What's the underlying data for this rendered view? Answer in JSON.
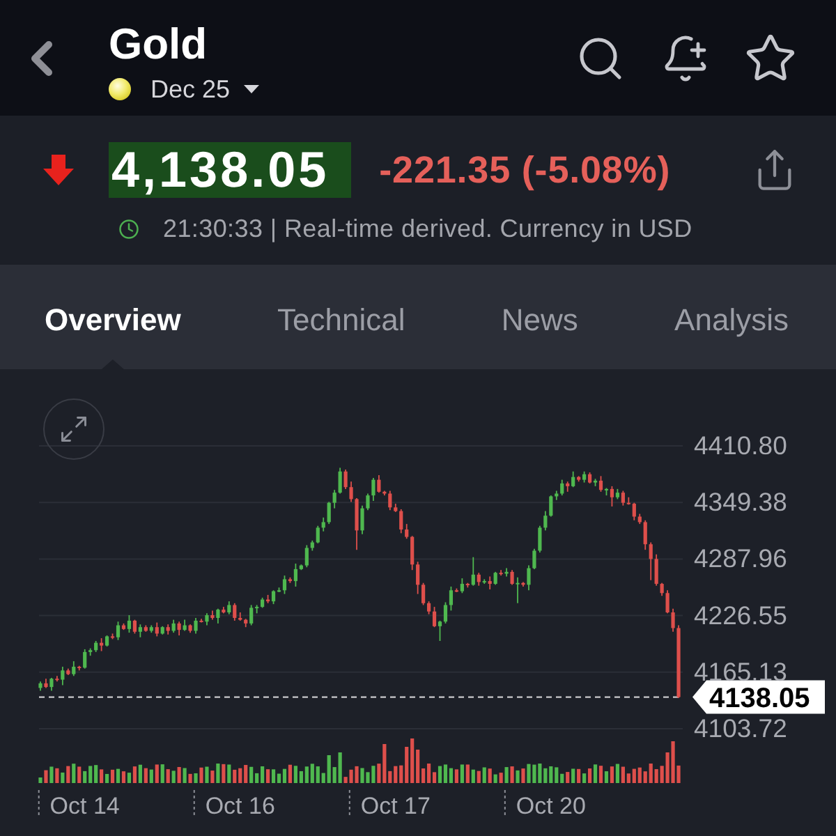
{
  "header": {
    "title": "Gold",
    "contract": "Dec 25"
  },
  "quote": {
    "down": true,
    "price": "4,138.05",
    "change": "-221.35 (-5.08%)",
    "status": "21:30:33 | Real-time derived. Currency in USD"
  },
  "tabs": [
    {
      "label": "Overview",
      "selected": true
    },
    {
      "label": "Technical",
      "selected": false
    },
    {
      "label": "News",
      "selected": false
    },
    {
      "label": "Analysis",
      "selected": false
    }
  ],
  "chart": {
    "chart_data": {
      "type": "candlestick",
      "categories": [
        null,
        null,
        null,
        null,
        null,
        null,
        null,
        null,
        "Oct 14",
        null,
        null,
        null,
        null,
        null,
        null,
        null,
        null,
        null,
        null,
        null,
        null,
        null,
        null,
        null,
        null,
        null,
        null,
        null,
        null,
        null,
        null,
        null,
        null,
        null,
        null,
        null,
        "Oct 16",
        null,
        null,
        null,
        null,
        null,
        null,
        null,
        null,
        null,
        null,
        null,
        null,
        null,
        null,
        null,
        null,
        null,
        null,
        null,
        null,
        null,
        null,
        null,
        null,
        null,
        null,
        null,
        "Oct 17",
        null,
        null,
        null,
        null,
        null,
        null,
        null,
        null,
        null,
        null,
        null,
        null,
        null,
        null,
        null,
        null,
        null,
        null,
        null,
        null,
        null,
        null,
        null,
        null,
        null,
        null,
        null,
        "Oct 20",
        null,
        null,
        null,
        null,
        null,
        null,
        null,
        null,
        null,
        null,
        null,
        null,
        null,
        null,
        null,
        null,
        null,
        null,
        null,
        null,
        null,
        null,
        null
      ],
      "ohlc": [
        [
          4148,
          4155,
          4145,
          4153
        ],
        [
          4153,
          4158,
          4148,
          4149
        ],
        [
          4149,
          4159,
          4145,
          4158
        ],
        [
          4158,
          4161,
          4155,
          4157
        ],
        [
          4157,
          4171,
          4151,
          4167
        ],
        [
          4167,
          4169,
          4162,
          4163
        ],
        [
          4163,
          4177,
          4161,
          4171
        ],
        [
          4171,
          4172,
          4167,
          4170
        ],
        [
          4170,
          4190,
          4169,
          4187
        ],
        [
          4187,
          4191,
          4183,
          4189
        ],
        [
          4189,
          4199,
          4187,
          4197
        ],
        [
          4197,
          4202,
          4188,
          4194
        ],
        [
          4194,
          4205,
          4193,
          4204
        ],
        [
          4204,
          4207,
          4201,
          4203
        ],
        [
          4203,
          4220,
          4200,
          4216
        ],
        [
          4216,
          4218,
          4211,
          4212
        ],
        [
          4212,
          4227,
          4208,
          4221
        ],
        [
          4221,
          4222,
          4207,
          4209
        ],
        [
          4209,
          4217,
          4203,
          4214
        ],
        [
          4214,
          4216,
          4209,
          4210
        ],
        [
          4210,
          4216,
          4208,
          4214
        ],
        [
          4214,
          4219,
          4204,
          4207
        ],
        [
          4207,
          4215,
          4206,
          4214
        ],
        [
          4214,
          4217,
          4206,
          4210
        ],
        [
          4210,
          4222,
          4208,
          4218
        ],
        [
          4218,
          4220,
          4205,
          4211
        ],
        [
          4211,
          4222,
          4210,
          4216
        ],
        [
          4216,
          4217,
          4208,
          4210
        ],
        [
          4210,
          4224,
          4207,
          4221
        ],
        [
          4221,
          4223,
          4219,
          4220
        ],
        [
          4220,
          4229,
          4216,
          4227
        ],
        [
          4227,
          4232,
          4222,
          4224
        ],
        [
          4224,
          4234,
          4218,
          4233
        ],
        [
          4233,
          4236,
          4229,
          4230
        ],
        [
          4230,
          4242,
          4228,
          4238
        ],
        [
          4238,
          4240,
          4221,
          4224
        ],
        [
          4224,
          4230,
          4221,
          4222
        ],
        [
          4222,
          4223,
          4214,
          4218
        ],
        [
          4218,
          4238,
          4216,
          4235
        ],
        [
          4235,
          4238,
          4229,
          4236
        ],
        [
          4236,
          4246,
          4235,
          4244
        ],
        [
          4244,
          4249,
          4240,
          4242
        ],
        [
          4242,
          4254,
          4239,
          4253
        ],
        [
          4253,
          4257,
          4252,
          4254
        ],
        [
          4254,
          4270,
          4250,
          4266
        ],
        [
          4266,
          4268,
          4262,
          4264
        ],
        [
          4264,
          4283,
          4258,
          4277
        ],
        [
          4277,
          4282,
          4276,
          4281
        ],
        [
          4281,
          4303,
          4279,
          4300
        ],
        [
          4300,
          4308,
          4297,
          4306
        ],
        [
          4306,
          4324,
          4305,
          4322
        ],
        [
          4322,
          4333,
          4318,
          4328
        ],
        [
          4328,
          4350,
          4326,
          4349
        ],
        [
          4349,
          4363,
          4343,
          4360
        ],
        [
          4360,
          4387,
          4359,
          4383
        ],
        [
          4383,
          4385,
          4364,
          4366
        ],
        [
          4366,
          4372,
          4350,
          4353
        ],
        [
          4353,
          4354,
          4298,
          4319
        ],
        [
          4319,
          4346,
          4315,
          4343
        ],
        [
          4343,
          4359,
          4341,
          4357
        ],
        [
          4357,
          4376,
          4351,
          4374
        ],
        [
          4374,
          4379,
          4360,
          4361
        ],
        [
          4361,
          4362,
          4357,
          4359
        ],
        [
          4359,
          4362,
          4341,
          4344
        ],
        [
          4344,
          4348,
          4339,
          4340
        ],
        [
          4340,
          4342,
          4316,
          4320
        ],
        [
          4320,
          4326,
          4310,
          4312
        ],
        [
          4312,
          4313,
          4276,
          4282
        ],
        [
          4282,
          4285,
          4250,
          4260
        ],
        [
          4260,
          4262,
          4238,
          4240
        ],
        [
          4240,
          4242,
          4228,
          4231
        ],
        [
          4231,
          4236,
          4214,
          4215
        ],
        [
          4215,
          4221,
          4199,
          4220
        ],
        [
          4220,
          4241,
          4218,
          4238
        ],
        [
          4238,
          4258,
          4232,
          4254
        ],
        [
          4254,
          4256,
          4252,
          4253
        ],
        [
          4253,
          4267,
          4251,
          4261
        ],
        [
          4261,
          4262,
          4257,
          4260
        ],
        [
          4260,
          4290,
          4259,
          4271
        ],
        [
          4271,
          4273,
          4259,
          4263
        ],
        [
          4263,
          4266,
          4261,
          4264
        ],
        [
          4264,
          4269,
          4255,
          4261
        ],
        [
          4261,
          4274,
          4260,
          4273
        ],
        [
          4273,
          4276,
          4270,
          4272
        ],
        [
          4272,
          4278,
          4269,
          4274
        ],
        [
          4274,
          4276,
          4260,
          4261
        ],
        [
          4261,
          4268,
          4240,
          4262
        ],
        [
          4262,
          4263,
          4258,
          4260
        ],
        [
          4260,
          4281,
          4254,
          4278
        ],
        [
          4278,
          4299,
          4277,
          4297
        ],
        [
          4297,
          4324,
          4295,
          4322
        ],
        [
          4322,
          4340,
          4319,
          4335
        ],
        [
          4335,
          4357,
          4334,
          4356
        ],
        [
          4356,
          4362,
          4352,
          4359
        ],
        [
          4359,
          4374,
          4357,
          4370
        ],
        [
          4370,
          4372,
          4361,
          4367
        ],
        [
          4367,
          4383,
          4366,
          4377
        ],
        [
          4377,
          4378,
          4372,
          4374
        ],
        [
          4374,
          4383,
          4371,
          4380
        ],
        [
          4380,
          4382,
          4370,
          4371
        ],
        [
          4371,
          4375,
          4367,
          4373
        ],
        [
          4373,
          4378,
          4361,
          4363
        ],
        [
          4363,
          4365,
          4357,
          4364
        ],
        [
          4364,
          4367,
          4345,
          4355
        ],
        [
          4355,
          4364,
          4353,
          4360
        ],
        [
          4360,
          4362,
          4346,
          4349
        ],
        [
          4349,
          4355,
          4347,
          4348
        ],
        [
          4348,
          4349,
          4330,
          4334
        ],
        [
          4334,
          4337,
          4326,
          4328
        ],
        [
          4328,
          4330,
          4298,
          4304
        ],
        [
          4304,
          4306,
          4265,
          4288
        ],
        [
          4288,
          4293,
          4259,
          4261
        ],
        [
          4261,
          4262,
          4248,
          4251
        ],
        [
          4251,
          4254,
          4229,
          4230
        ],
        [
          4230,
          4234,
          4209,
          4213
        ],
        [
          4213,
          4216,
          4137,
          4138.05
        ]
      ],
      "ylim": [
        4103.72,
        4410.8
      ],
      "yticks": [
        {
          "value": 4410.8,
          "label": "4410.80"
        },
        {
          "value": 4349.38,
          "label": "4349.38"
        },
        {
          "value": 4287.96,
          "label": "4287.96"
        },
        {
          "value": 4226.55,
          "label": "4226.55"
        },
        {
          "value": 4165.13,
          "label": "4165.13"
        },
        {
          "value": 4103.72,
          "label": "4103.72"
        }
      ],
      "grid": true,
      "ref_lines": [
        {
          "axis": "y",
          "value": 4138.05,
          "label": "4138.05"
        }
      ]
    }
  }
}
